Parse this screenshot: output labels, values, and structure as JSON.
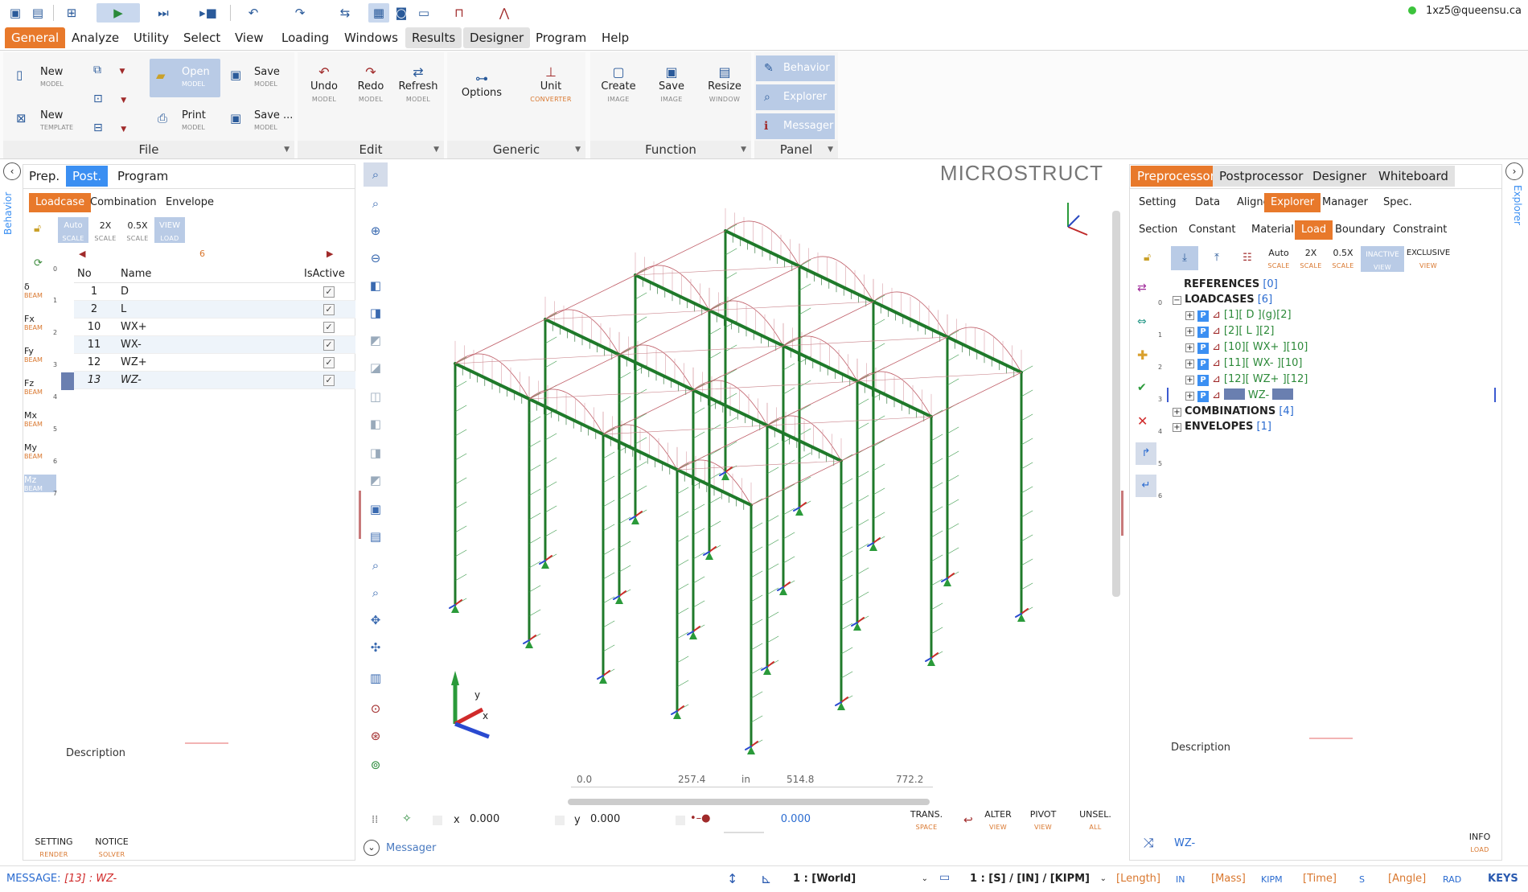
{
  "user": {
    "email": "1xz5@queensu.ca"
  },
  "menu": [
    "General",
    "Analyze",
    "Utility",
    "Select",
    "View",
    "Loading",
    "Windows",
    "Results",
    "Designer",
    "Program",
    "Help"
  ],
  "ribbon": {
    "file": {
      "new_model": "New",
      "new_model_sub": "MODEL",
      "new_template": "New",
      "new_template_sub": "TEMPLATE",
      "open": "Open",
      "open_sub": "MODEL",
      "print": "Print",
      "print_sub": "MODEL",
      "save": "Save",
      "save_sub": "MODEL",
      "saveas": "Save ...",
      "saveas_sub": "MODEL",
      "label": "File"
    },
    "edit": {
      "undo": "Undo",
      "undo_sub": "MODEL",
      "redo": "Redo",
      "redo_sub": "MODEL",
      "refresh": "Refresh",
      "refresh_sub": "MODEL",
      "label": "Edit"
    },
    "generic": {
      "options": "Options",
      "unit": "Unit",
      "unit_sub": "CONVERTER",
      "label": "Generic"
    },
    "function": {
      "create": "Create",
      "create_sub": "IMAGE",
      "save": "Save",
      "save_sub": "IMAGE",
      "resize": "Resize",
      "resize_sub": "WINDOW",
      "label": "Function"
    },
    "panel": {
      "behavior": "Behavior",
      "explorer": "Explorer",
      "messager": "Messager",
      "label": "Panel"
    }
  },
  "left": {
    "side_label": "Behavior",
    "tabs": [
      "Prep.",
      "Post.",
      "Program"
    ],
    "subtabs": [
      "Loadcase",
      "Combination",
      "Envelope"
    ],
    "scale": {
      "auto": "Auto",
      "auto_sub": "SCALE",
      "x2": "2X",
      "x2_sub": "SCALE",
      "half": "0.5X",
      "half_sub": "SCALE",
      "view": "VIEW",
      "view_sub": "LOAD"
    },
    "count": "6",
    "columns": {
      "no": "No",
      "name": "Name",
      "active": "IsActive"
    },
    "rows": [
      {
        "no": "1",
        "name": "D"
      },
      {
        "no": "2",
        "name": "L"
      },
      {
        "no": "10",
        "name": "WX+"
      },
      {
        "no": "11",
        "name": "WX-"
      },
      {
        "no": "12",
        "name": "WZ+"
      },
      {
        "no": "13",
        "name": "WZ-"
      }
    ],
    "side_items": [
      {
        "t": "δ",
        "s": "BEAM",
        "n": "1"
      },
      {
        "t": "Fx",
        "s": "BEAM",
        "n": "2"
      },
      {
        "t": "Fy",
        "s": "BEAM",
        "n": "3"
      },
      {
        "t": "Fz",
        "s": "BEAM",
        "n": "4"
      },
      {
        "t": "Mx",
        "s": "BEAM",
        "n": "5"
      },
      {
        "t": "My",
        "s": "BEAM",
        "n": "6"
      },
      {
        "t": "Mz",
        "s": "BEAM",
        "n": "7"
      }
    ],
    "zero": "0",
    "description": "Description",
    "setting": "SETTING",
    "setting_sub": "RENDER",
    "notice": "NOTICE",
    "notice_sub": "SOLVER"
  },
  "view": {
    "title": "MICROSTRUCT",
    "ruler": [
      "0.0",
      "257.4",
      "in",
      "514.8",
      "772.2"
    ],
    "x_label": "x",
    "x_val": "0.000",
    "y_label": "y",
    "y_val": "0.000",
    "d_val": "0.000",
    "trans": "TRANS.",
    "trans_sub": "SPACE",
    "alter": "ALTER",
    "alter_sub": "VIEW",
    "pivot": "PIVOT",
    "pivot_sub": "VIEW",
    "unsel": "UNSEL.",
    "unsel_sub": "ALL",
    "messager": "Messager"
  },
  "right": {
    "side_label": "Explorer",
    "tabs": [
      "Preprocessor",
      "Postprocessor",
      "Designer",
      "Whiteboard"
    ],
    "subtabs": [
      "Setting",
      "Data",
      "Aligner",
      "Explorer",
      "Manager",
      "Spec."
    ],
    "subtabs2": [
      "Section",
      "Constant",
      "Material",
      "Load",
      "Boundary",
      "Constraint"
    ],
    "scale": {
      "auto": "Auto",
      "auto_sub": "SCALE",
      "x2": "2X",
      "x2_sub": "SCALE",
      "half": "0.5X",
      "half_sub": "SCALE",
      "inactive": "INACTIVE",
      "inactive_sub": "VIEW",
      "exclusive": "EXCLUSIVE",
      "exclusive_sub": "VIEW"
    },
    "tree": {
      "references": "REFERENCES",
      "references_cnt": "[0]",
      "loadcases": "LOADCASES",
      "loadcases_cnt": "[6]",
      "items": [
        "[1][ D ](g)[2]",
        "[2][ L ][2]",
        "[10][ WX+ ][10]",
        "[11][ WX- ][10]",
        "[12][ WZ+ ][12]",
        "WZ-"
      ],
      "combinations": "COMBINATIONS",
      "combinations_cnt": "[4]",
      "envelopes": "ENVELOPES",
      "envelopes_cnt": "[1]"
    },
    "row_nums": [
      "0",
      "1",
      "2",
      "3",
      "4",
      "5",
      "6"
    ],
    "description": "Description",
    "footer_name": "WZ-",
    "info": "INFO",
    "info_sub": "LOAD"
  },
  "status": {
    "message_label": "MESSAGE:",
    "message": "[13] : WZ-",
    "world": "1 : [World]",
    "units": "1 : [S] / [IN] / [KIPM]",
    "length": "[Length]",
    "length_val": "IN",
    "mass": "[Mass]",
    "mass_val": "KIPM",
    "time": "[Time]",
    "time_val": "S",
    "angle": "[Angle]",
    "angle_val": "RAD",
    "keys": "KEYS"
  },
  "colors": {
    "accent": "#e8792b",
    "blue": "#3b8ff2",
    "structure_green": "#1f7a2a",
    "moment_red": "#c0606a"
  }
}
